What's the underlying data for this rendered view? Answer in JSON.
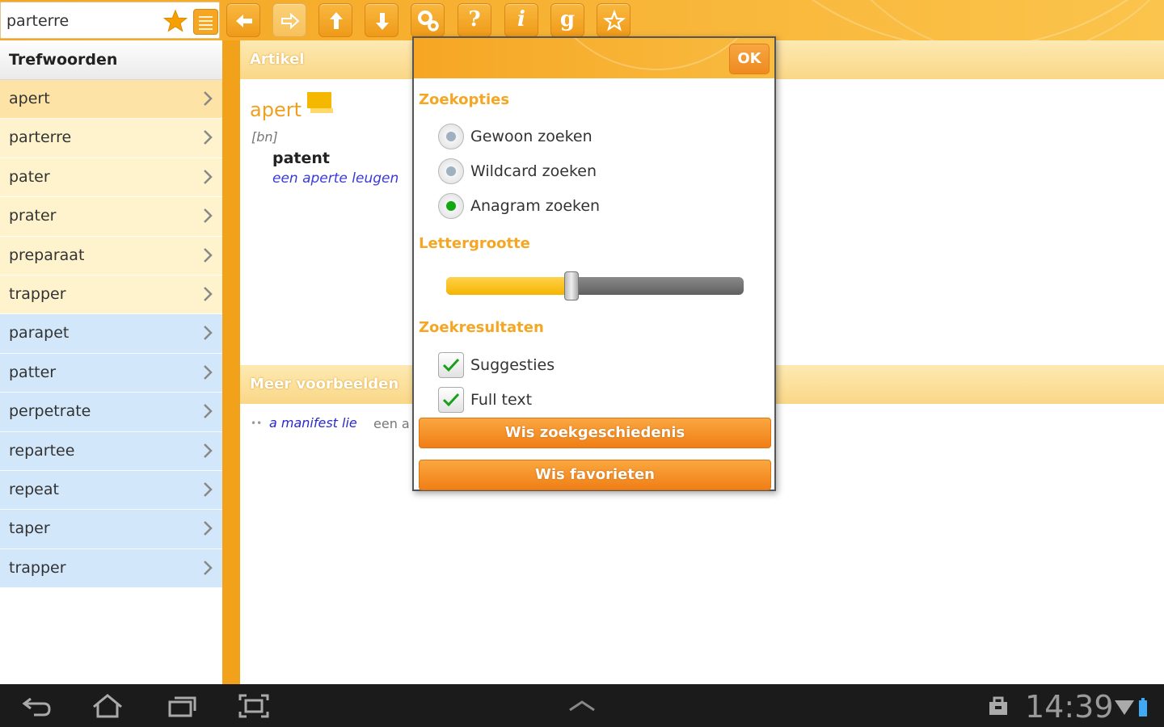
{
  "search": {
    "value": "parterre"
  },
  "toolbar": {
    "buttons": [
      {
        "name": "back-button",
        "icon": "arrow-left-icon"
      },
      {
        "name": "forward-button",
        "icon": "arrow-right-icon",
        "disabled": true
      },
      {
        "name": "up-button",
        "icon": "arrow-up-icon"
      },
      {
        "name": "down-button",
        "icon": "arrow-down-icon"
      },
      {
        "name": "settings-button",
        "icon": "gears-icon"
      },
      {
        "name": "help-button",
        "glyph": "?"
      },
      {
        "name": "info-button",
        "glyph": "i"
      },
      {
        "name": "google-button",
        "glyph": "g"
      },
      {
        "name": "favorite-button",
        "icon": "star-outline-icon"
      }
    ]
  },
  "sidebar": {
    "title": "Trefwoorden",
    "items": [
      {
        "label": "apert",
        "kind": "sel"
      },
      {
        "label": "parterre",
        "kind": "yellow"
      },
      {
        "label": "pater",
        "kind": "yellow"
      },
      {
        "label": "prater",
        "kind": "yellow"
      },
      {
        "label": "preparaat",
        "kind": "yellow"
      },
      {
        "label": "trapper",
        "kind": "yellow"
      },
      {
        "label": "parapet",
        "kind": "blue"
      },
      {
        "label": "patter",
        "kind": "blue"
      },
      {
        "label": "perpetrate",
        "kind": "blue"
      },
      {
        "label": "repartee",
        "kind": "blue"
      },
      {
        "label": "repeat",
        "kind": "blue"
      },
      {
        "label": "taper",
        "kind": "blue"
      },
      {
        "label": "trapper",
        "kind": "blue"
      }
    ]
  },
  "article": {
    "section_title": "Artikel",
    "headword": "apert",
    "grammar": "[bn]",
    "translation": "patent",
    "example": "een aperte leugen",
    "more_section_title": "Meer voorbeelden",
    "more_example_bullet": "••",
    "more_example_en": "a manifest lie",
    "more_example_nl": "een a"
  },
  "dialog": {
    "ok_label": "OK",
    "search_options_title": "Zoekopties",
    "search_options": [
      {
        "label": "Gewoon zoeken",
        "selected": false
      },
      {
        "label": "Wildcard zoeken",
        "selected": false
      },
      {
        "label": "Anagram zoeken",
        "selected": true
      }
    ],
    "font_size_title": "Lettergrootte",
    "font_size_level": 0.42,
    "results_title": "Zoekresultaten",
    "result_options": [
      {
        "label": "Suggesties",
        "checked": true
      },
      {
        "label": "Full text",
        "checked": true
      }
    ],
    "clear_history_label": "Wis zoekgeschiedenis",
    "clear_favorites_label": "Wis favorieten"
  },
  "system": {
    "time": "14:39"
  },
  "colors": {
    "accent": "#f6a623",
    "selected_row": "#fde4a6",
    "yellow_row": "#fef3cc",
    "blue_row": "#d3e7fa"
  }
}
